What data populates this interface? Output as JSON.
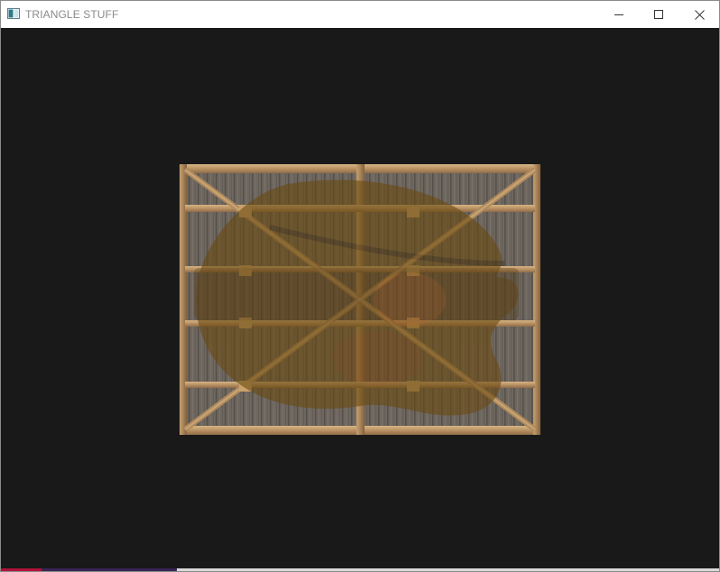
{
  "window": {
    "title": "TRIANGLE STUFF",
    "icon": "app-window-icon",
    "controls": {
      "minimize_icon": "minimize-icon",
      "maximize_icon": "maximize-icon",
      "close_icon": "close-icon"
    }
  },
  "viewport": {
    "background": "#191919",
    "content": "textured-quad-crate-with-blended-overlay-image"
  },
  "colors": {
    "titlebar_bg": "#ffffff",
    "title_text": "#8a8a8a",
    "crate_wood": "#7b6a55",
    "crate_frame": "#c9a26b",
    "overlay_tint": "#8a6a2a"
  }
}
